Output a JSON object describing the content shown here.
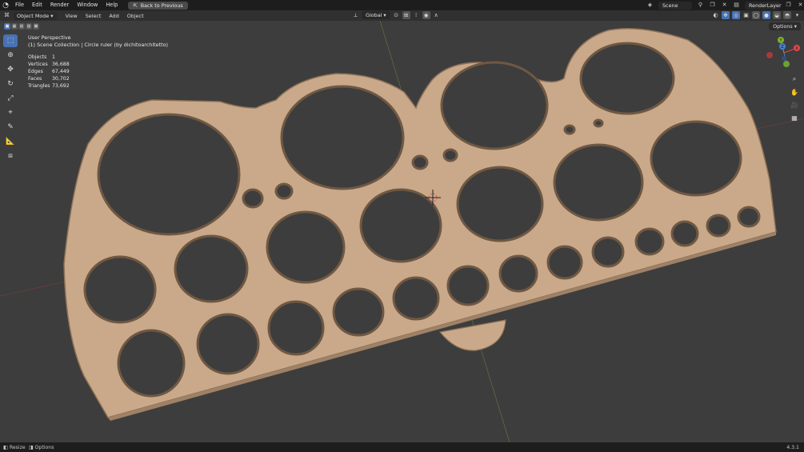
{
  "topbar": {
    "menus": [
      "File",
      "Edit",
      "Render",
      "Window",
      "Help"
    ],
    "back_button": "Back to Previous",
    "scene": "Scene",
    "render_layer": "RenderLayer"
  },
  "header": {
    "mode": "Object Mode",
    "menus": [
      "View",
      "Select",
      "Add",
      "Object"
    ],
    "orientation": "Global",
    "options": "Options"
  },
  "overlay": {
    "perspective": "User Perspective",
    "collection": "(1) Scene Collection | Circle ruler (by dichitoarchitetto)"
  },
  "stats": [
    {
      "k": "Objects",
      "v": "1"
    },
    {
      "k": "Vertices",
      "v": "36,688"
    },
    {
      "k": "Edges",
      "v": "67,449"
    },
    {
      "k": "Faces",
      "v": "30,702"
    },
    {
      "k": "Triangles",
      "v": "73,692"
    }
  ],
  "status": {
    "resize": "Resize",
    "options": "Options",
    "version": "4.3.1"
  },
  "colors": {
    "ruler": "#c9a98a",
    "ruler_edge": "#8e7157",
    "background": "#3d3d3d",
    "accent": "#4772b3"
  }
}
